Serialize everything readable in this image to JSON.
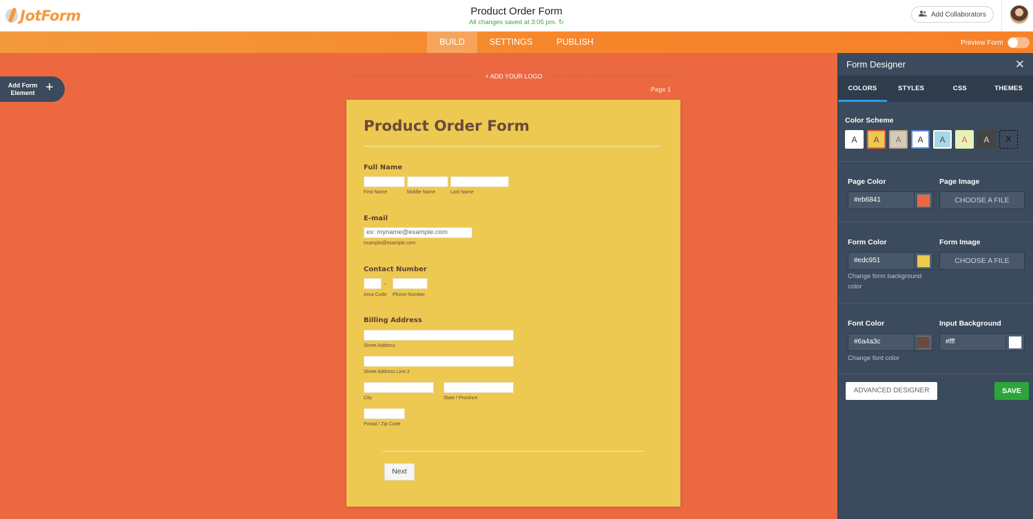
{
  "brand": {
    "logo_text": "JotForm"
  },
  "header": {
    "title": "Product Order Form",
    "saved_status": "All changes saved at 3:05 pm. ↻",
    "collab_label": "Add Collaborators"
  },
  "nav": {
    "tabs": [
      "BUILD",
      "SETTINGS",
      "PUBLISH"
    ],
    "active_tab": "BUILD",
    "preview_label": "Preview Form"
  },
  "builder": {
    "add_element_label": "Add Form Element",
    "add_logo_label": "+ ADD YOUR LOGO",
    "page_label": "Page 1"
  },
  "form": {
    "title": "Product Order Form",
    "fields": {
      "full_name": {
        "label": "Full Name",
        "sub": [
          "First Name",
          "Middle Name",
          "Last Name"
        ]
      },
      "email": {
        "label": "E-mail",
        "placeholder": "ex: myname@example.com",
        "sub": "example@example.com"
      },
      "contact": {
        "label": "Contact Number",
        "dash": "-",
        "sub": [
          "Area Code",
          "Phone Number"
        ]
      },
      "billing": {
        "label": "Billing Address",
        "sub": [
          "Street Address",
          "Street Address Line 2",
          "City",
          "State / Province",
          "Postal / Zip Code"
        ]
      }
    },
    "next_button": "Next"
  },
  "panel": {
    "title": "Form Designer",
    "close_icon": "close-icon",
    "tabs": [
      "COLORS",
      "STYLES",
      "CSS",
      "THEMES"
    ],
    "active_tab": "COLORS",
    "color_scheme": {
      "label": "Color Scheme",
      "swatches": [
        {
          "letter": "A",
          "bg": "#ffffff",
          "fg": "#333333",
          "border": "#ffffff"
        },
        {
          "letter": "A",
          "bg": "#edc951",
          "fg": "#6a4a3c",
          "border": "#eb6841"
        },
        {
          "letter": "A",
          "bg": "#d6cbb8",
          "fg": "#777777",
          "border": "#b5a993"
        },
        {
          "letter": "A",
          "bg": "#ffffff",
          "fg": "#333333",
          "border": "#5b8bd6"
        },
        {
          "letter": "A",
          "bg": "#a6d8e8",
          "fg": "#555555",
          "border": "#ffffff"
        },
        {
          "letter": "A",
          "bg": "#e8f2b8",
          "fg": "#e85a5a",
          "border": "#e8f2b8"
        },
        {
          "letter": "A",
          "bg": "#444444",
          "fg": "#dddddd",
          "border": "#444444"
        },
        {
          "letter": "X",
          "bg": "#3b4a5c",
          "fg": "#111111",
          "border": "#111111"
        }
      ]
    },
    "page_color": {
      "label": "Page Color",
      "value": "#eb6841",
      "chip": "#eb6841"
    },
    "page_image": {
      "label": "Page Image",
      "button": "CHOOSE A FILE"
    },
    "form_color": {
      "label": "Form Color",
      "value": "#edc951",
      "chip": "#edc951",
      "hint": "Change form background color"
    },
    "form_image": {
      "label": "Form Image",
      "button": "CHOOSE A FILE"
    },
    "font_color": {
      "label": "Font Color",
      "value": "#6a4a3c",
      "chip": "#6a4a3c",
      "hint": "Change font color"
    },
    "input_bg": {
      "label": "Input Background",
      "value": "#fff",
      "chip": "#ffffff"
    },
    "advanced_button": "ADVANCED DESIGNER",
    "save_button": "SAVE"
  }
}
